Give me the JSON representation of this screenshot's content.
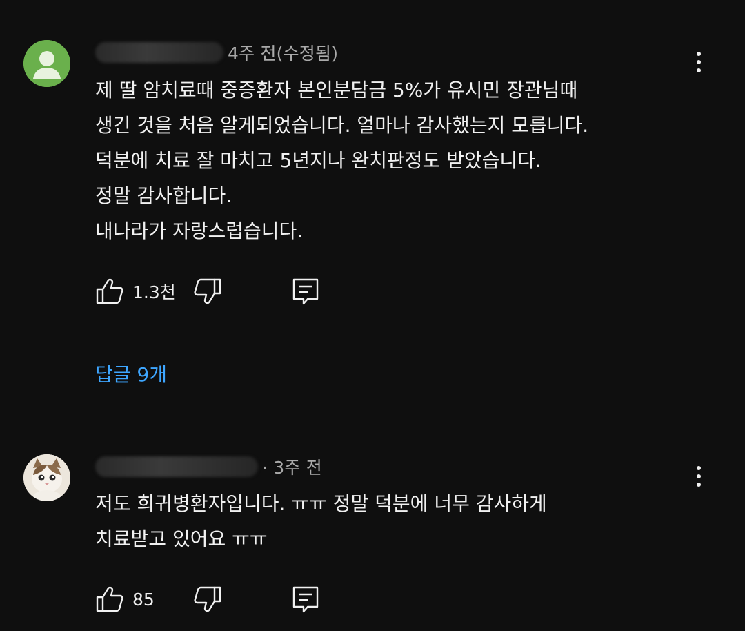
{
  "comments": [
    {
      "time": "4주 전(수정됨)",
      "lines": [
        "제 딸 암치료때 중증환자 본인분담금 5%가 유시민 장관님때",
        "생긴 것을 처음 알게되었습니다. 얼마나 감사했는지 모릅니다.",
        "덕분에 치료 잘 마치고 5년지나 완치판정도 받았습니다.",
        "정말 감사합니다.",
        "내나라가 자랑스럽습니다."
      ],
      "likes": "1.3천",
      "replies": "답글 9개"
    },
    {
      "time": "· 3주 전",
      "lines": [
        "저도 희귀병환자입니다. ㅠㅠ 정말 덕분에 너무 감사하게",
        "치료받고 있어요 ㅠㅠ"
      ],
      "likes": "85"
    }
  ],
  "icons": {
    "like": "thumbs-up-icon",
    "dislike": "thumbs-down-icon",
    "reply": "reply-icon",
    "more": "more-vert-icon"
  },
  "colors": {
    "background": "#0f0f0f",
    "text": "#f1f1f1",
    "secondary_text": "#aaaaaa",
    "link": "#3ea6ff",
    "default_avatar": "#6ab04c"
  }
}
